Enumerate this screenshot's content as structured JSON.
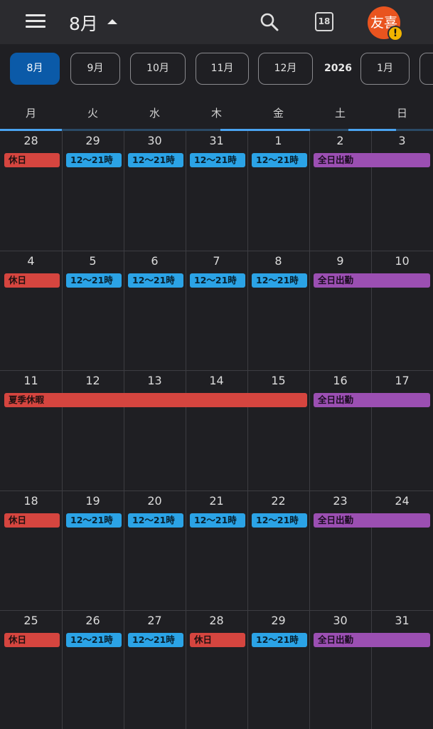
{
  "header": {
    "title": "8月",
    "today_day": "18",
    "avatar_text": "友喜",
    "warning_glyph": "!"
  },
  "month_chips": [
    {
      "label": "8月",
      "active": true
    },
    {
      "label": "9月",
      "active": false
    },
    {
      "label": "10月",
      "active": false
    },
    {
      "label": "11月",
      "active": false
    },
    {
      "label": "12月",
      "active": false
    },
    {
      "label": "1月",
      "active": false
    }
  ],
  "year_label": "2026",
  "weekdays": [
    "月",
    "火",
    "水",
    "木",
    "金",
    "土",
    "日"
  ],
  "weeks": [
    {
      "days": [
        "28",
        "29",
        "30",
        "31",
        "1",
        "2",
        "3"
      ],
      "events": [
        {
          "start": 0,
          "span": 1,
          "label": "休日",
          "color": "red"
        },
        {
          "start": 1,
          "span": 1,
          "label": "12～21時",
          "color": "blue"
        },
        {
          "start": 2,
          "span": 1,
          "label": "12～21時",
          "color": "blue"
        },
        {
          "start": 3,
          "span": 1,
          "label": "12～21時",
          "color": "blue"
        },
        {
          "start": 4,
          "span": 1,
          "label": "12～21時",
          "color": "blue"
        },
        {
          "start": 5,
          "span": 2,
          "label": "全日出勤",
          "color": "purple"
        }
      ]
    },
    {
      "days": [
        "4",
        "5",
        "6",
        "7",
        "8",
        "9",
        "10"
      ],
      "events": [
        {
          "start": 0,
          "span": 1,
          "label": "休日",
          "color": "red"
        },
        {
          "start": 1,
          "span": 1,
          "label": "12～21時",
          "color": "blue"
        },
        {
          "start": 2,
          "span": 1,
          "label": "12～21時",
          "color": "blue"
        },
        {
          "start": 3,
          "span": 1,
          "label": "12～21時",
          "color": "blue"
        },
        {
          "start": 4,
          "span": 1,
          "label": "12～21時",
          "color": "blue"
        },
        {
          "start": 5,
          "span": 2,
          "label": "全日出勤",
          "color": "purple"
        }
      ]
    },
    {
      "days": [
        "11",
        "12",
        "13",
        "14",
        "15",
        "16",
        "17"
      ],
      "events": [
        {
          "start": 0,
          "span": 5,
          "label": "夏季休暇",
          "color": "red"
        },
        {
          "start": 5,
          "span": 2,
          "label": "全日出勤",
          "color": "purple"
        }
      ]
    },
    {
      "days": [
        "18",
        "19",
        "20",
        "21",
        "22",
        "23",
        "24"
      ],
      "events": [
        {
          "start": 0,
          "span": 1,
          "label": "休日",
          "color": "red"
        },
        {
          "start": 1,
          "span": 1,
          "label": "12～21時",
          "color": "blue"
        },
        {
          "start": 2,
          "span": 1,
          "label": "12～21時",
          "color": "blue"
        },
        {
          "start": 3,
          "span": 1,
          "label": "12～21時",
          "color": "blue"
        },
        {
          "start": 4,
          "span": 1,
          "label": "12～21時",
          "color": "blue"
        },
        {
          "start": 5,
          "span": 2,
          "label": "全日出勤",
          "color": "purple"
        }
      ]
    },
    {
      "days": [
        "25",
        "26",
        "27",
        "28",
        "29",
        "30",
        "31"
      ],
      "events": [
        {
          "start": 0,
          "span": 1,
          "label": "休日",
          "color": "red"
        },
        {
          "start": 1,
          "span": 1,
          "label": "12～21時",
          "color": "blue"
        },
        {
          "start": 2,
          "span": 1,
          "label": "12～21時",
          "color": "blue"
        },
        {
          "start": 3,
          "span": 1,
          "label": "休日",
          "color": "red"
        },
        {
          "start": 4,
          "span": 1,
          "label": "12～21時",
          "color": "blue"
        },
        {
          "start": 5,
          "span": 2,
          "label": "全日出勤",
          "color": "purple"
        }
      ]
    }
  ],
  "colors": {
    "red": "#d5453f",
    "blue": "#2ba3e6",
    "purple": "#9b4fb2",
    "active_chip": "#0b5aa8",
    "avatar": "#e9541f"
  }
}
